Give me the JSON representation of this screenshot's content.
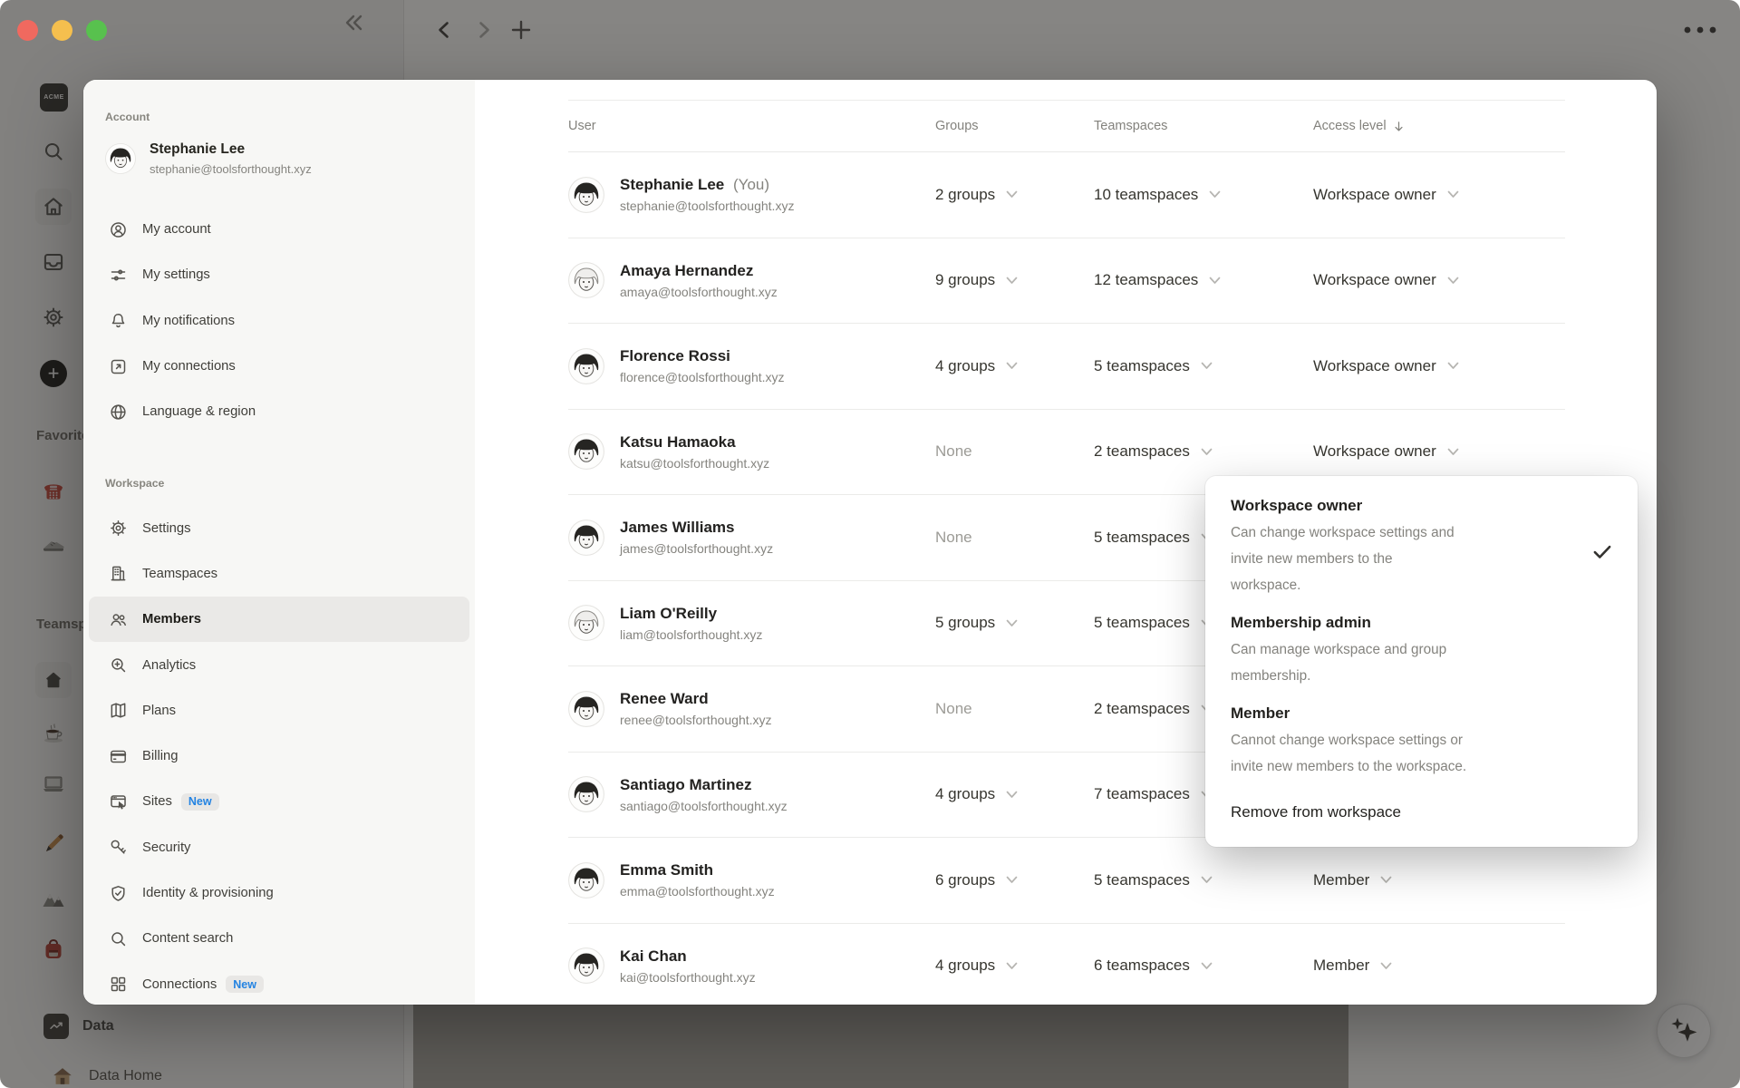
{
  "window": {
    "nav_icons": [
      "collapse-sidebar",
      "back",
      "forward",
      "new-tab",
      "more"
    ],
    "traffic_lights": [
      "close",
      "minimize",
      "zoom"
    ]
  },
  "app_sidebar": {
    "workspace_badge": "ACME",
    "nav_icon_names": [
      "search-icon",
      "home-icon",
      "inbox-icon",
      "gear-icon",
      "new-page-icon"
    ],
    "favorites_label": "Favorites",
    "teamspaces_label": "Teamspaces",
    "favorite_item_icons": [
      "telephone-icon",
      "sneaker-icon"
    ],
    "teamspace_item_icons": [
      "house-icon",
      "coffee-icon",
      "laptop-icon",
      "pencil-icon",
      "mountain-icon",
      "backpack-icon"
    ],
    "data_item_label": "Data",
    "data_home_label": "Data Home"
  },
  "settings_nav": {
    "account_header": "Account",
    "user": {
      "name": "Stephanie Lee",
      "email": "stephanie@toolsforthought.xyz"
    },
    "account_items": [
      {
        "icon": "person-circle-icon",
        "label": "My account"
      },
      {
        "icon": "sliders-icon",
        "label": "My settings"
      },
      {
        "icon": "bell-icon",
        "label": "My notifications"
      },
      {
        "icon": "arrow-up-right-icon",
        "label": "My connections"
      },
      {
        "icon": "globe-icon",
        "label": "Language & region"
      }
    ],
    "workspace_header": "Workspace",
    "workspace_items": [
      {
        "icon": "gear-icon",
        "label": "Settings"
      },
      {
        "icon": "building-icon",
        "label": "Teamspaces"
      },
      {
        "icon": "people-icon",
        "label": "Members",
        "selected": true
      },
      {
        "icon": "magnifier-plus-icon",
        "label": "Analytics"
      },
      {
        "icon": "map-icon",
        "label": "Plans"
      },
      {
        "icon": "credit-card-icon",
        "label": "Billing"
      },
      {
        "icon": "browser-cursor-icon",
        "label": "Sites",
        "badge": "New"
      },
      {
        "icon": "key-icon",
        "label": "Security"
      },
      {
        "icon": "shield-check-icon",
        "label": "Identity & provisioning"
      },
      {
        "icon": "magnifier-icon",
        "label": "Content search"
      },
      {
        "icon": "grid-icon",
        "label": "Connections",
        "badge": "New"
      }
    ]
  },
  "members_table": {
    "columns": {
      "user": "User",
      "groups": "Groups",
      "teamspaces": "Teamspaces",
      "access": "Access level"
    },
    "access_sort": "descending",
    "rows": [
      {
        "name": "Stephanie Lee",
        "you_suffix": "(You)",
        "email": "stephanie@toolsforthought.xyz",
        "groups": "2 groups",
        "teamspaces": "10 teamspaces",
        "access": "Workspace owner",
        "hair": "dark"
      },
      {
        "name": "Amaya Hernandez",
        "email": "amaya@toolsforthought.xyz",
        "groups": "9 groups",
        "teamspaces": "12 teamspaces",
        "access": "Workspace owner",
        "hair": "light"
      },
      {
        "name": "Florence Rossi",
        "email": "florence@toolsforthought.xyz",
        "groups": "4 groups",
        "teamspaces": "5 teamspaces",
        "access": "Workspace owner",
        "hair": "dark"
      },
      {
        "name": "Katsu Hamaoka",
        "email": "katsu@toolsforthought.xyz",
        "groups": "None",
        "teamspaces": "2 teamspaces",
        "access": "Workspace owner",
        "hair": "dark"
      },
      {
        "name": "James Williams",
        "email": "james@toolsforthought.xyz",
        "groups": "None",
        "teamspaces": "5 teamspaces",
        "access": "",
        "hair": "dark"
      },
      {
        "name": "Liam O'Reilly",
        "email": "liam@toolsforthought.xyz",
        "groups": "5 groups",
        "teamspaces": "5 teamspaces",
        "access": "",
        "hair": "light"
      },
      {
        "name": "Renee Ward",
        "email": "renee@toolsforthought.xyz",
        "groups": "None",
        "teamspaces": "2 teamspaces",
        "access": "",
        "hair": "dark"
      },
      {
        "name": "Santiago Martinez",
        "email": "santiago@toolsforthought.xyz",
        "groups": "4 groups",
        "teamspaces": "7 teamspaces",
        "access": "",
        "hair": "dark"
      },
      {
        "name": "Emma Smith",
        "email": "emma@toolsforthought.xyz",
        "groups": "6 groups",
        "teamspaces": "5 teamspaces",
        "access": "Member",
        "hair": "dark"
      },
      {
        "name": "Kai Chan",
        "email": "kai@toolsforthought.xyz",
        "groups": "4 groups",
        "teamspaces": "6 teamspaces",
        "access": "Member",
        "hair": "dark"
      }
    ]
  },
  "access_menu": {
    "options": [
      {
        "label": "Workspace owner",
        "description": "Can change workspace settings and\ninvite new members to the\nworkspace.",
        "selected": true
      },
      {
        "label": "Membership admin",
        "description": "Can manage workspace and group\nmembership.",
        "selected": false
      },
      {
        "label": "Member",
        "description": "Cannot change workspace settings or\ninvite new members to the workspace.",
        "selected": false
      }
    ],
    "remove_label": "Remove from workspace"
  },
  "colors": {
    "accent_blue": "#2383e2",
    "badge_bg": "#e8e7e5",
    "selected_item_bg": "#eae9e7",
    "traffic_red": "#f0695f",
    "traffic_yellow": "#f5bf4e",
    "traffic_green": "#58c14e"
  }
}
